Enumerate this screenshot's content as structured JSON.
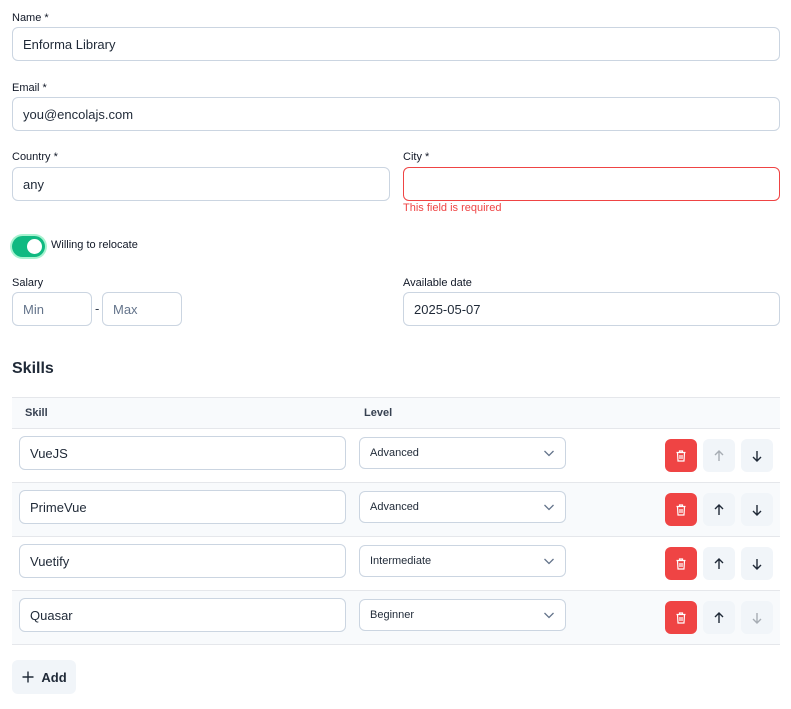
{
  "form": {
    "name": {
      "label": "Name *",
      "value": "Enforma Library"
    },
    "email": {
      "label": "Email *",
      "value": "you@encolajs.com"
    },
    "country": {
      "label": "Country *",
      "value": "any"
    },
    "city": {
      "label": "City *",
      "value": "",
      "error": "This field is required"
    },
    "relocate": {
      "label": "Willing to relocate",
      "checked": true
    },
    "salary": {
      "label": "Salary",
      "min_placeholder": "Min",
      "max_placeholder": "Max",
      "separator": "-"
    },
    "available_date": {
      "label": "Available date",
      "value": "2025-05-07"
    }
  },
  "skills": {
    "title": "Skills",
    "columns": {
      "skill": "Skill",
      "level": "Level"
    },
    "rows": [
      {
        "skill": "VueJS",
        "level": "Advanced"
      },
      {
        "skill": "PrimeVue",
        "level": "Advanced"
      },
      {
        "skill": "Vuetify",
        "level": "Intermediate"
      },
      {
        "skill": "Quasar",
        "level": "Beginner"
      }
    ],
    "add_label": "Add"
  },
  "colors": {
    "accent": "#10b981",
    "danger": "#ef4444"
  }
}
